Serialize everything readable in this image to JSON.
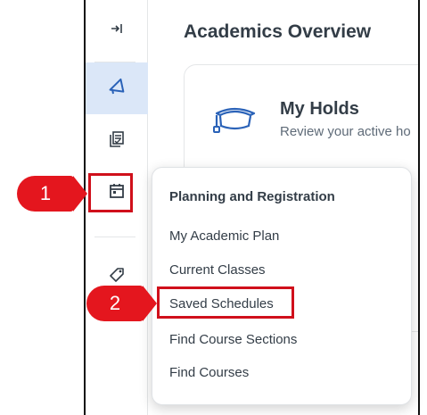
{
  "page": {
    "title": "Academics Overview"
  },
  "sidebar": {
    "items": [
      {
        "name": "collapse",
        "icon": "collapse-right-icon"
      },
      {
        "name": "announcements",
        "icon": "megaphone-icon"
      },
      {
        "name": "reports",
        "icon": "reports-icon"
      },
      {
        "name": "calendar",
        "icon": "calendar-icon"
      },
      {
        "name": "tag",
        "icon": "tag-icon"
      }
    ]
  },
  "holds_card": {
    "icon": "graduation-cap-icon",
    "title": "My Holds",
    "subtitle": "Review your active ho"
  },
  "menu": {
    "header": "Planning and Registration",
    "items": [
      "My Academic Plan",
      "Current Classes",
      "Saved Schedules",
      "Find Course Sections",
      "Find Courses"
    ]
  },
  "callouts": {
    "step1": "1",
    "step2": "2"
  },
  "colors": {
    "accent": "#e4161e",
    "highlight_bg": "#dbe7f8",
    "text": "#333d47"
  }
}
